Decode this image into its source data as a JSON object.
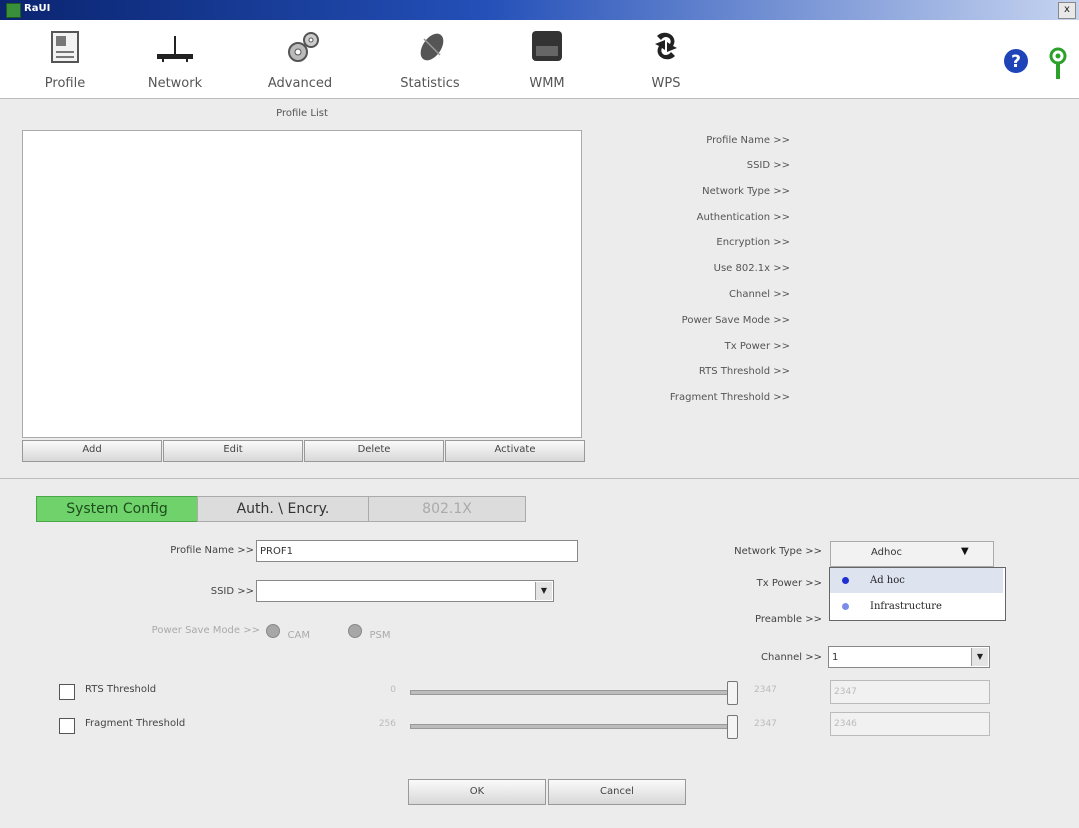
{
  "window": {
    "title": "RaUI",
    "close_label": "x"
  },
  "toolbar": {
    "items": [
      {
        "label": "Profile",
        "icon": "profile-icon"
      },
      {
        "label": "Network",
        "icon": "network-icon"
      },
      {
        "label": "Advanced",
        "icon": "advanced-icon"
      },
      {
        "label": "Statistics",
        "icon": "statistics-icon"
      },
      {
        "label": "WMM",
        "icon": "wmm-icon"
      },
      {
        "label": "WPS",
        "icon": "wps-icon"
      }
    ],
    "brand_letter": "R"
  },
  "profile_list": {
    "title": "Profile List",
    "items": [],
    "buttons": {
      "add": "Add",
      "edit": "Edit",
      "delete": "Delete",
      "activate": "Activate"
    }
  },
  "profile_details": [
    "Profile Name >>",
    "SSID >>",
    "Network Type >>",
    "Authentication >>",
    "Encryption >>",
    "Use 802.1x >>",
    "Channel >>",
    "Power Save Mode >>",
    "Tx Power >>",
    "RTS Threshold >>",
    "Fragment Threshold >>"
  ],
  "config": {
    "tabs": {
      "system": "System Config",
      "auth": "Auth. \\ Encry.",
      "x8021": "802.1X"
    },
    "profile_name": {
      "label": "Profile Name >>",
      "value": "PROF1"
    },
    "ssid": {
      "label": "SSID >>",
      "value": ""
    },
    "power_save": {
      "label": "Power Save Mode >>",
      "cam": "CAM",
      "psm": "PSM"
    },
    "network_type": {
      "label": "Network Type >>",
      "value": "Adhoc",
      "options": [
        "Ad hoc",
        "Infrastructure"
      ]
    },
    "tx_power": {
      "label": "Tx Power >>"
    },
    "preamble": {
      "label": "Preamble >>"
    },
    "channel": {
      "label": "Channel >>",
      "value": "1"
    },
    "rts": {
      "label": "RTS Threshold",
      "min": "0",
      "max": "2347",
      "value": "2347"
    },
    "fragment": {
      "label": "Fragment Threshold",
      "min": "256",
      "max": "2347",
      "value": "2346"
    },
    "ok_label": "OK",
    "cancel_label": "Cancel"
  },
  "colors": {
    "accent_tab": "#6fd26a",
    "title_bar": "#0a2470",
    "option_dot": "#1f2fd0"
  }
}
